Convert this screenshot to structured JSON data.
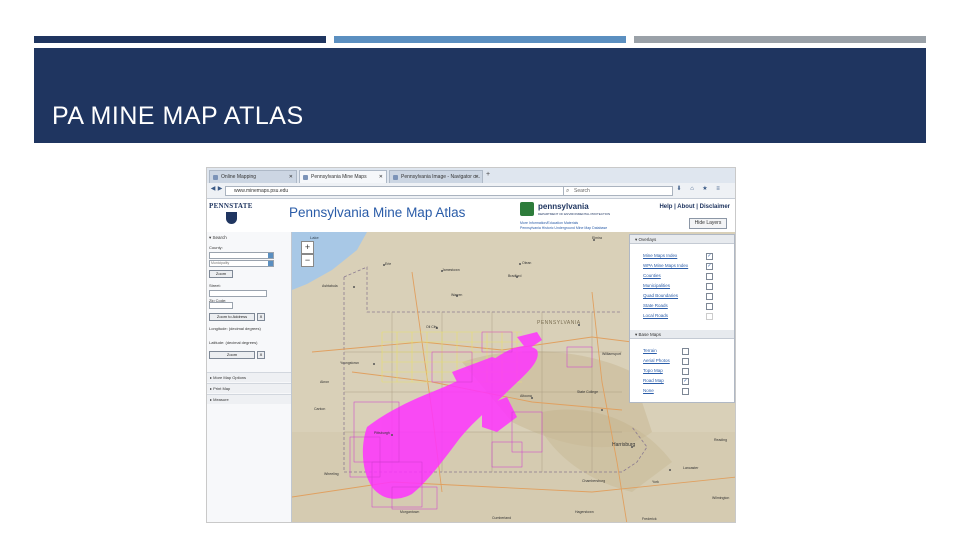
{
  "slide": {
    "title": "PA MINE MAP ATLAS"
  },
  "browser": {
    "tabs": [
      {
        "label": "Online Mapping",
        "active": false
      },
      {
        "label": "Pennsylvania Mine Maps",
        "active": true
      },
      {
        "label": "Pennsylvania Image - Navigator o...",
        "active": false
      }
    ],
    "new_tab": "+",
    "url": "www.minemaps.psu.edu",
    "search_placeholder": "Search",
    "back": "◀",
    "forward": "▶"
  },
  "app": {
    "title": "Pennsylvania Mine Map Atlas",
    "psu_logo_text": "PENNSTATE",
    "dep_name": "pennsylvania",
    "dep_sub": "DEPARTMENT OF ENVIRONMENTAL PROTECTION",
    "dep_link1": "More Information/Education Materials",
    "dep_link2": "Pennsylvania Historic Underground Mine Map Database",
    "links": {
      "help": "Help",
      "about": "About",
      "disclaimer": "Disclaimer",
      "sep": "|"
    },
    "hide_layers": "Hide Layers"
  },
  "sidebar": {
    "search_header": "▾ Search",
    "county_label": "County:",
    "municipality_value": "Municipality",
    "zoom_btn": "Zoom",
    "street_label": "Street:",
    "zip_label": "Zip Code:",
    "zoom_address_btn": "Zoom to Address",
    "x_label": "X",
    "longitude_label": "Longitude: (decimal degrees)",
    "latitude_label": "Latitude: (decimal degrees)",
    "zoom_btn2": "Zoom",
    "more_map_options": "▸ More Map Options",
    "print_map": "▸ Print Map",
    "measure": "▸ Measure"
  },
  "map": {
    "zoom_in": "+",
    "zoom_out": "−",
    "lake_label": "Lake",
    "state_label": "PENNSYLVANIA",
    "places": [
      {
        "name": "Erie"
      },
      {
        "name": "Jamestown"
      },
      {
        "name": "Olean"
      },
      {
        "name": "Bradford"
      },
      {
        "name": "Elmira"
      },
      {
        "name": "Ashtabula"
      },
      {
        "name": "Warren"
      },
      {
        "name": "Oil City"
      },
      {
        "name": "Youngstown"
      },
      {
        "name": "Akron"
      },
      {
        "name": "Pittsburgh"
      },
      {
        "name": "Altoona"
      },
      {
        "name": "State College"
      },
      {
        "name": "Harrisburg"
      },
      {
        "name": "Reading"
      },
      {
        "name": "Lancaster"
      },
      {
        "name": "York"
      },
      {
        "name": "Chambersburg"
      },
      {
        "name": "Hagerstown"
      },
      {
        "name": "Cumberland"
      },
      {
        "name": "Morgantown"
      },
      {
        "name": "Wheeling"
      },
      {
        "name": "Wilmington"
      },
      {
        "name": "Frederick"
      },
      {
        "name": "Canton"
      },
      {
        "name": "Williamsport"
      },
      {
        "name": "Scranton"
      },
      {
        "name": "Sayre"
      }
    ]
  },
  "overlays": {
    "header": "▾ Overlays",
    "items": [
      {
        "label": "Mine Maps Index",
        "checked": true
      },
      {
        "label": "WPA Mine Maps Index",
        "checked": true
      },
      {
        "label": "Counties",
        "checked": false
      },
      {
        "label": "Municipalities",
        "checked": false
      },
      {
        "label": "Quad Boundaries",
        "checked": false
      },
      {
        "label": "State Roads",
        "checked": false
      },
      {
        "label": "Local Roads",
        "checked": false
      }
    ],
    "base_header": "▾ Base Maps",
    "base_items": [
      {
        "label": "Terrain",
        "checked": false
      },
      {
        "label": "Aerial Photos",
        "checked": false
      },
      {
        "label": "Topo Map",
        "checked": false
      },
      {
        "label": "Road Map",
        "checked": true
      },
      {
        "label": "None",
        "checked": false
      }
    ],
    "check_mark": "✓"
  },
  "colors": {
    "banner": "#1f3560",
    "bar_mid": "#5b8fc0",
    "bar_light": "#9aa1a8",
    "mine_overlay": "#ff33ff",
    "grid_overlay": "#e8e070",
    "title_blue": "#2a5ca8"
  }
}
